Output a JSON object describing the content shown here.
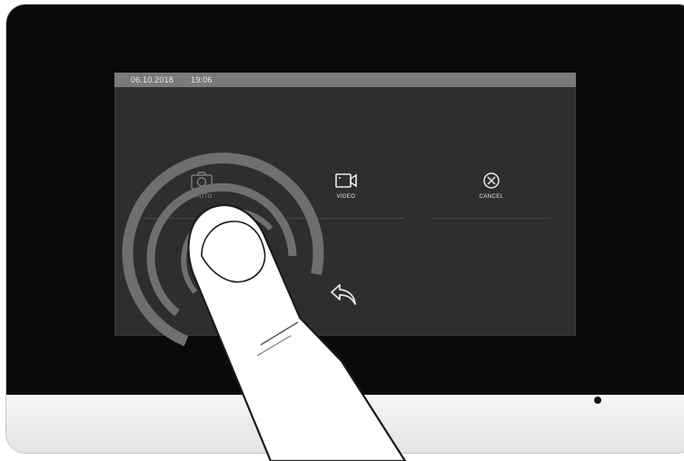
{
  "status_bar": {
    "date": "06.10.2018",
    "time": "19:06"
  },
  "actions": [
    {
      "label": "PHOTO",
      "icon": "camera-icon"
    },
    {
      "label": "VIDEO",
      "icon": "video-camera-icon"
    },
    {
      "label": "CANCEL",
      "icon": "cancel-icon"
    }
  ],
  "back": {
    "icon": "back-arrow-icon"
  },
  "colors": {
    "bezel": "#0a0a0a",
    "screen": "#2e2e2e",
    "status_bar": "#7a7a7a",
    "touch_ripple": "#777777",
    "device_frame": "#f0f0f0"
  },
  "gesture": {
    "icon": "tapping-finger-icon",
    "target": "PHOTO"
  }
}
